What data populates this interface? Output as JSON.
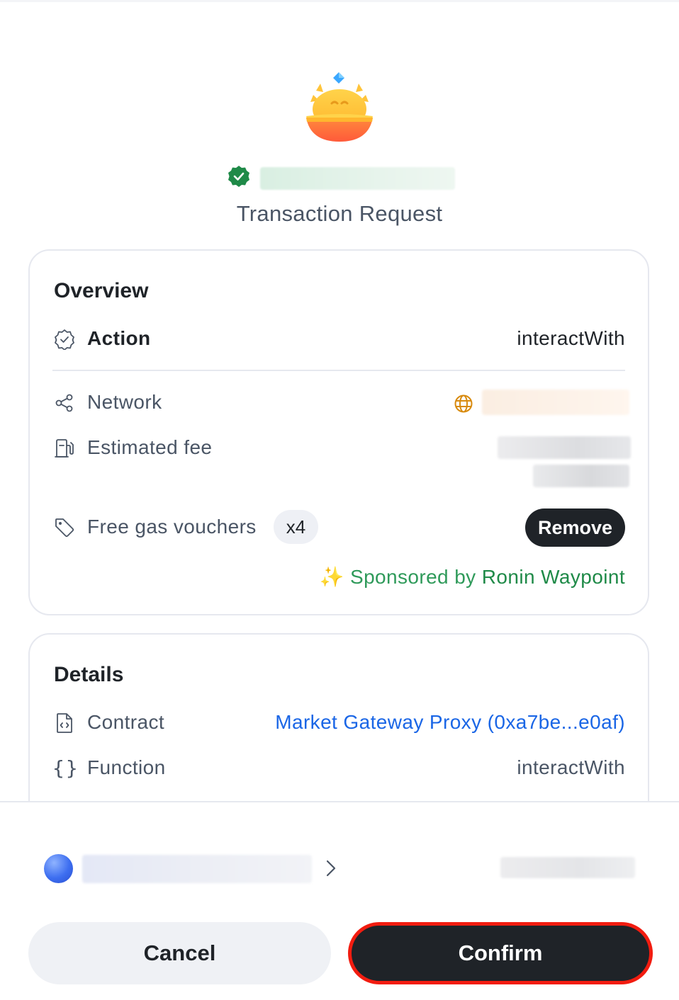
{
  "header": {
    "title": "Transaction Request"
  },
  "overview": {
    "title": "Overview",
    "action_label": "Action",
    "action_value": "interactWith",
    "network_label": "Network",
    "fee_label": "Estimated fee",
    "vouchers_label": "Free gas vouchers",
    "vouchers_count": "x4",
    "remove_label": "Remove",
    "sponsored_prefix": "Sponsored by",
    "sponsored_brand": "Ronin Waypoint",
    "sponsored_icon": "sparkles-icon"
  },
  "details": {
    "title": "Details",
    "contract_label": "Contract",
    "contract_value": "Market Gateway Proxy (0xa7be...e0af)",
    "function_label": "Function",
    "function_value": "interactWith"
  },
  "footer": {
    "cancel_label": "Cancel",
    "confirm_label": "Confirm"
  },
  "colors": {
    "confirm_highlight": "#f21c10",
    "sponsored_green": "#2f9a5a",
    "link_blue": "#1a66e6",
    "dark_button": "#1f2328"
  }
}
